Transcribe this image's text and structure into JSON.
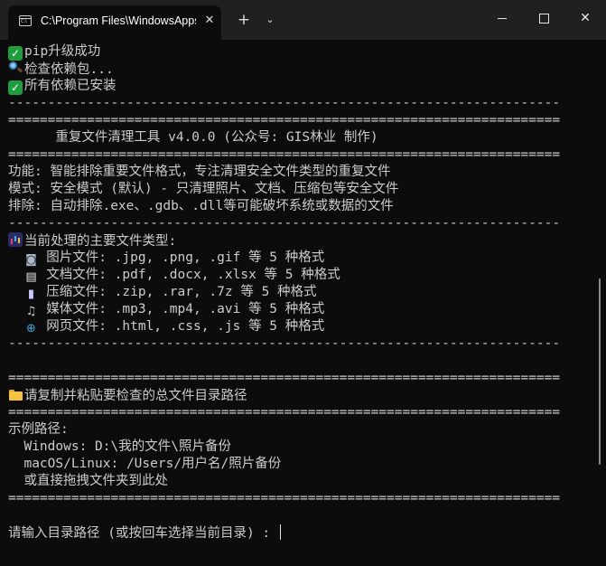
{
  "window": {
    "tab_title": "C:\\Program Files\\WindowsApps\\Microsoft.WindowsTerminal",
    "tab_close": "✕",
    "new_tab": "+",
    "dropdown": "⌄",
    "minimize_label": "",
    "maximize_label": "",
    "close": "✕"
  },
  "terminal": {
    "l1": "pip升级成功",
    "l2": "检查依赖包...",
    "l3": "所有依赖已安装",
    "sep_dash": "----------------------------------------------------------------------",
    "sep_eq": "======================================================================",
    "title": "      重复文件清理工具 v4.0.0 (公众号: GIS林业 制作)",
    "func": "功能: 智能排除重要文件格式，专注清理安全文件类型的重复文件",
    "mode": "模式: 安全模式 (默认) - 只清理照片、文档、压缩包等安全文件",
    "exclude": "排除: 自动排除.exe、.gdb、.dll等可能破坏系统或数据的文件",
    "types_header": "当前处理的主要文件类型:",
    "type_image": "图片文件: .jpg, .png, .gif 等 5 种格式",
    "type_doc": "文档文件: .pdf, .docx, .xlsx 等 5 种格式",
    "type_zip": "压缩文件: .zip, .rar, .7z 等 5 种格式",
    "type_media": "媒体文件: .mp3, .mp4, .avi 等 5 种格式",
    "type_web": "网页文件: .html, .css, .js 等 5 种格式",
    "prompt_header": "请复制并粘贴要检查的总文件目录路径",
    "example_title": "示例路径:",
    "example_win": "  Windows: D:\\我的文件\\照片备份",
    "example_mac": "  macOS/Linux: /Users/用户名/照片备份",
    "example_drag": "  或直接拖拽文件夹到此处",
    "input_prompt": "请输入目录路径 (或按回车选择当前目录) : "
  },
  "colors": {
    "background": "#0c0c0c",
    "titlebar": "#202020",
    "text": "#cccccc"
  },
  "icons": {
    "check": "check-mark-icon",
    "search": "magnifier-icon",
    "chart": "bar-chart-icon",
    "camera": "camera-icon",
    "doc": "document-icon",
    "zip": "compression-icon",
    "media": "music-note-icon",
    "web": "globe-icon",
    "folder": "folder-icon"
  }
}
